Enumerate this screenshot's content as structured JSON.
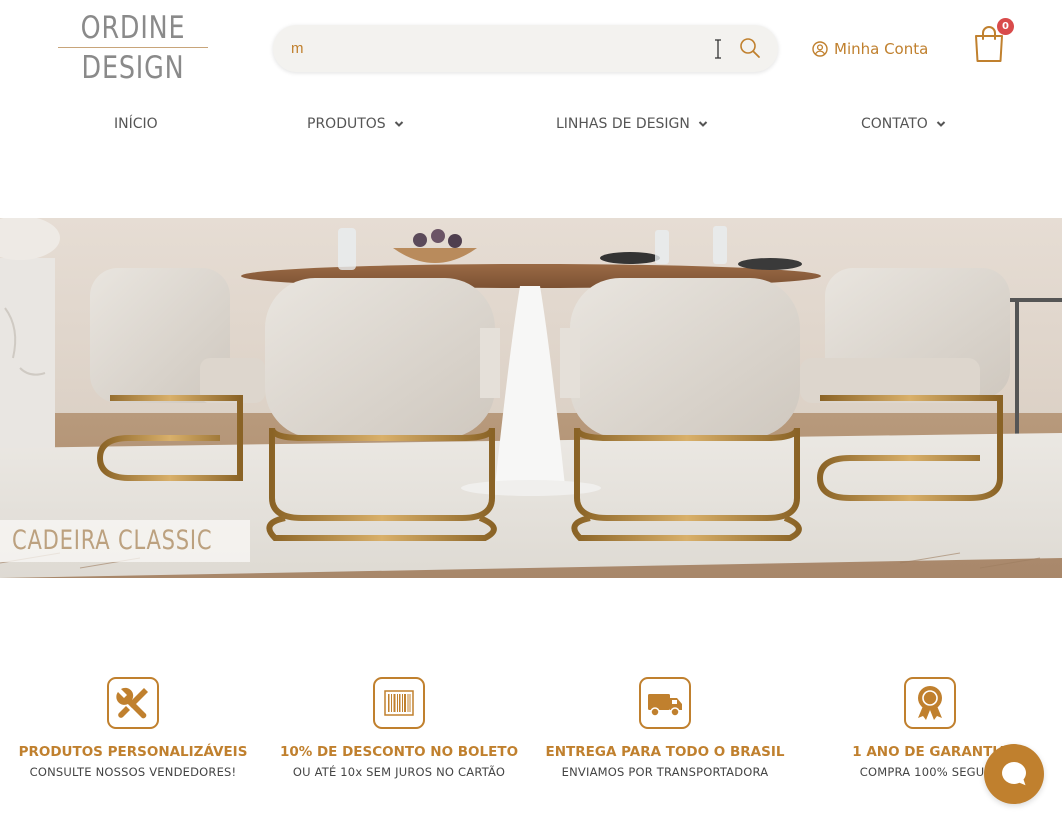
{
  "brand": {
    "logo_line1": "ORDINE",
    "logo_line2": "DESIGN",
    "accent": "#c0802e"
  },
  "search": {
    "value": "m",
    "placeholder": ""
  },
  "account": {
    "label": "Minha Conta"
  },
  "cart": {
    "count": "0"
  },
  "nav": {
    "items": [
      {
        "label": "INÍCIO",
        "has_dropdown": false
      },
      {
        "label": "PRODUTOS",
        "has_dropdown": true
      },
      {
        "label": "LINHAS DE DESIGN",
        "has_dropdown": true
      },
      {
        "label": "CONTATO",
        "has_dropdown": true
      }
    ]
  },
  "hero": {
    "caption": "CADEIRA CLASSIC"
  },
  "features": [
    {
      "icon": "tools-icon",
      "title": "PRODUTOS PERSONALIZÁVEIS",
      "subtitle": "CONSULTE NOSSOS VENDEDORES!"
    },
    {
      "icon": "barcode-icon",
      "title": "10% DE DESCONTO NO BOLETO",
      "subtitle": "OU ATÉ 10x SEM JUROS NO CARTÃO"
    },
    {
      "icon": "truck-icon",
      "title": "ENTREGA PARA TODO O BRASIL",
      "subtitle": "ENVIAMOS POR TRANSPORTADORA"
    },
    {
      "icon": "award-icon",
      "title": "1 ANO DE GARANTIA",
      "subtitle": "COMPRA 100% SEGURA"
    }
  ],
  "chat": {
    "icon": "chat-bubble-icon"
  }
}
